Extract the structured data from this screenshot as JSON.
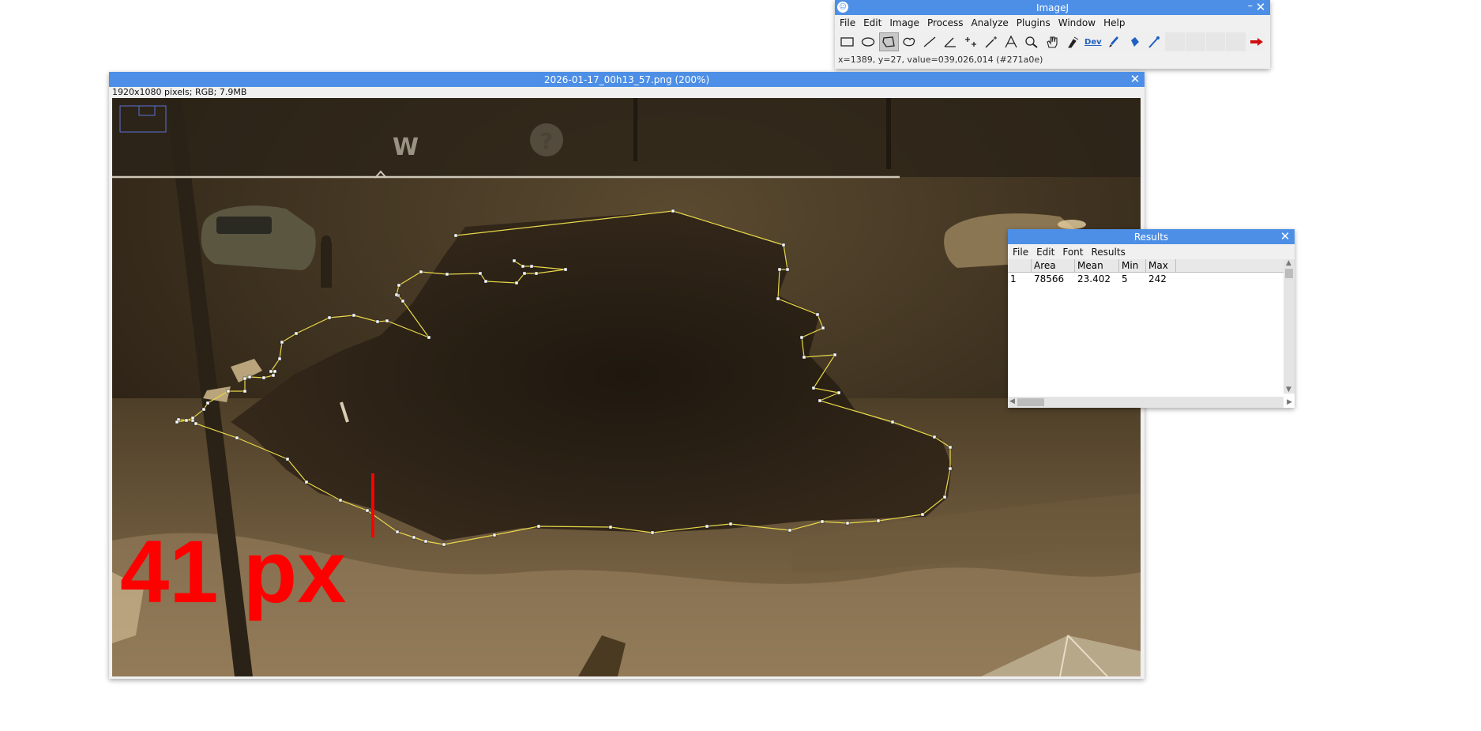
{
  "imagej": {
    "title": "ImageJ",
    "menu": [
      "File",
      "Edit",
      "Image",
      "Process",
      "Analyze",
      "Plugins",
      "Window",
      "Help"
    ],
    "tools": [
      "rectangle-tool-icon",
      "oval-tool-icon",
      "polygon-tool-icon",
      "freehand-tool-icon",
      "line-tool-icon",
      "angle-tool-icon",
      "multipoint-tool-icon",
      "wand-tool-icon",
      "text-tool-icon",
      "magnifier-tool-icon",
      "hand-tool-icon",
      "color-picker-icon",
      "dev-tool-icon",
      "brush-tool-icon",
      "flood-fill-tool-icon",
      "pipette-tool-icon",
      "blank-slot-1",
      "blank-slot-2",
      "blank-slot-3",
      "blank-slot-4",
      "arrow-launcher-icon"
    ],
    "dev_label": "Dev",
    "status": "x=1389, y=27, value=039,026,014 (#271a0e)"
  },
  "image_window": {
    "title": "2026-01-17_00h13_57.png (200%)",
    "info": "1920x1080 pixels; RGB; 7.9MB",
    "overlay_text": "41 px",
    "hud_letter": "W",
    "hud_icon": "?"
  },
  "results": {
    "title": "Results",
    "menu": [
      "File",
      "Edit",
      "Font",
      "Results"
    ],
    "columns": [
      "",
      "Area",
      "Mean",
      "Min",
      "Max"
    ],
    "rows": [
      [
        "1",
        "78566",
        "23.402",
        "5",
        "242"
      ]
    ]
  },
  "colors": {
    "titlebar": "#4d8fe6",
    "roi": "#e8d84a",
    "overlay_red": "#ff0000"
  }
}
